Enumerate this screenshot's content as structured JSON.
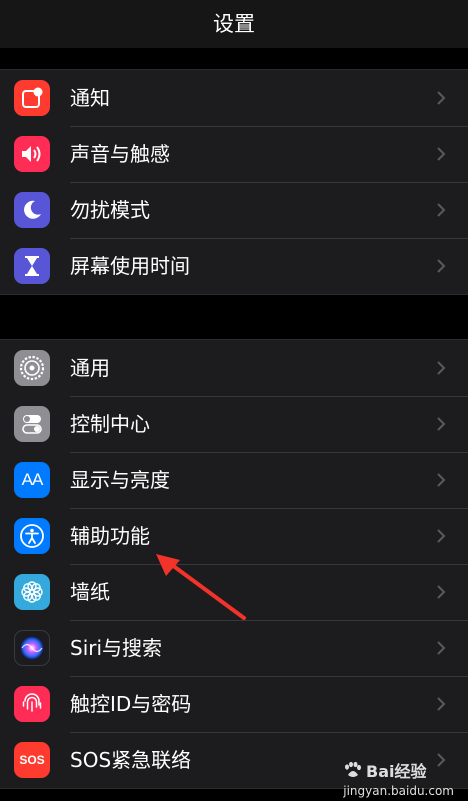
{
  "header": {
    "title": "设置"
  },
  "group1": [
    {
      "label": "通知",
      "icon": "notifications-icon",
      "color": "#ff3b30"
    },
    {
      "label": "声音与触感",
      "icon": "sound-icon",
      "color": "#ff2d55"
    },
    {
      "label": "勿扰模式",
      "icon": "moon-icon",
      "color": "#5856d6"
    },
    {
      "label": "屏幕使用时间",
      "icon": "hourglass-icon",
      "color": "#5856d6"
    }
  ],
  "group2": [
    {
      "label": "通用",
      "icon": "gear-icon",
      "color": "#8e8e93"
    },
    {
      "label": "控制中心",
      "icon": "toggle-icon",
      "color": "#8e8e93"
    },
    {
      "label": "显示与亮度",
      "icon": "text-size-icon",
      "color": "#007aff"
    },
    {
      "label": "辅助功能",
      "icon": "accessibility-icon",
      "color": "#007aff"
    },
    {
      "label": "墙纸",
      "icon": "wallpaper-flower-icon",
      "color": "#34aadc"
    },
    {
      "label": "Siri与搜索",
      "icon": "siri-icon",
      "color": "#1c1c1e"
    },
    {
      "label": "触控ID与密码",
      "icon": "fingerprint-icon",
      "color": "#ff2d55"
    },
    {
      "label": "SOS紧急联络",
      "icon": "sos-icon",
      "color": "#ff3b30"
    }
  ],
  "icon_text": {
    "text_size": "AA",
    "sos": "SOS"
  },
  "watermark": {
    "brand": "Bai经验",
    "url": "jingyan.baidu.com"
  }
}
